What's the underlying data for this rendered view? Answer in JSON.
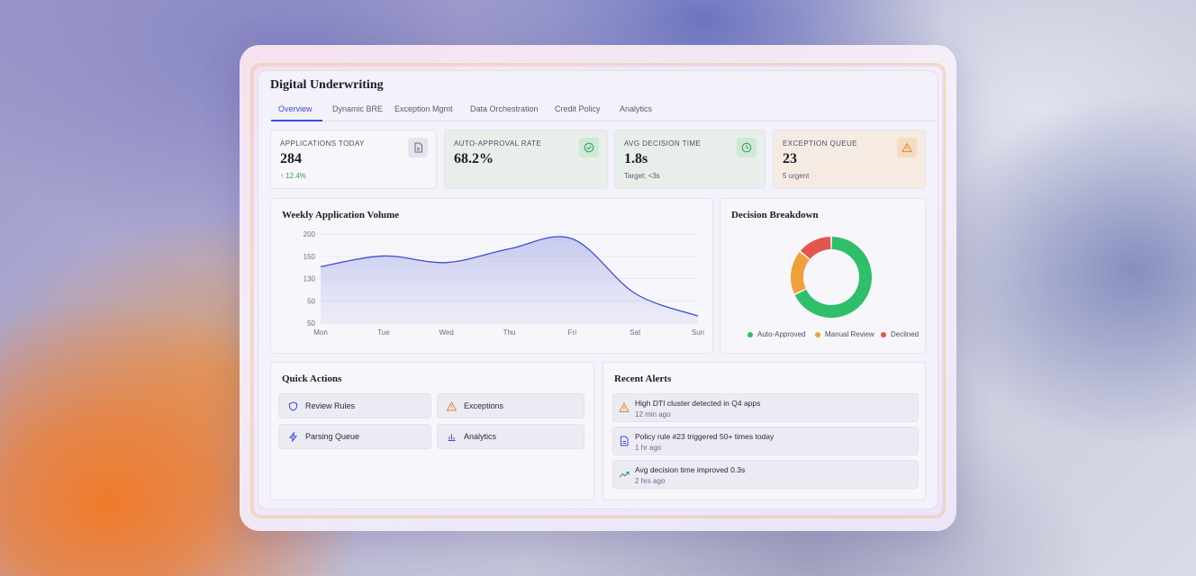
{
  "app": {
    "title": "Digital Underwriting",
    "tabs": [
      "Overview",
      "Dynamic BRE",
      "Exception Mgmt",
      "Data Orchestration",
      "Credit Policy",
      "Analytics"
    ]
  },
  "stats": [
    {
      "label": "APPLICATIONS TODAY",
      "value": "284",
      "sub": "↑ 12.4%",
      "icon": "document-icon"
    },
    {
      "label": "AUTO-APPROVAL RATE",
      "value": "68.2%",
      "sub": "",
      "icon": "check-circle-icon"
    },
    {
      "label": "AVG DECISION TIME",
      "value": "1.8s",
      "sub": "Target: <3s",
      "icon": "clock-icon"
    },
    {
      "label": "EXCEPTION QUEUE",
      "value": "23",
      "sub": "5 urgent",
      "icon": "warning-icon"
    }
  ],
  "colors": {
    "accent": "#3b4fcf",
    "approved": "#2fbf6a",
    "review": "#f0a03a",
    "declined": "#e5554f",
    "positive": "#2e9e5c"
  },
  "chart_data": [
    {
      "type": "area",
      "title": "Weekly Application Volume",
      "categories": [
        "Mon",
        "Tue",
        "Wed",
        "Thu",
        "Fri",
        "Sat",
        "Sun"
      ],
      "values": [
        145,
        163,
        152,
        175,
        192,
        100,
        62
      ],
      "y_ticks": [
        "200",
        "150",
        "130",
        "50",
        "50"
      ],
      "ylim": [
        50,
        200
      ],
      "grid": true
    },
    {
      "type": "pie",
      "title": "Decision Breakdown",
      "labels": [
        "Auto-Approved",
        "Manual Review",
        "Declined"
      ],
      "values": [
        68,
        18,
        14
      ],
      "legend_position": "bottom"
    }
  ],
  "quick_actions": {
    "title": "Quick Actions",
    "items": [
      {
        "label": "Review Rules",
        "icon": "shield-icon"
      },
      {
        "label": "Exceptions",
        "icon": "warning-icon"
      },
      {
        "label": "Parsing Queue",
        "icon": "lightning-icon"
      },
      {
        "label": "Analytics",
        "icon": "bar-chart-icon"
      }
    ]
  },
  "alerts": {
    "title": "Recent Alerts",
    "items": [
      {
        "text": "High DTI cluster detected in Q4 apps",
        "time": "12 min ago",
        "icon": "warning-icon"
      },
      {
        "text": "Policy rule #23 triggered 50+ times today",
        "time": "1 hr ago",
        "icon": "document-icon"
      },
      {
        "text": "Avg decision time improved 0.3s",
        "time": "2 hrs ago",
        "icon": "trending-up-icon"
      }
    ]
  }
}
